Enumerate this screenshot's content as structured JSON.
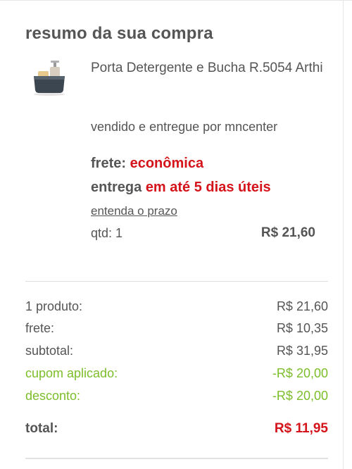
{
  "summary": {
    "title": "resumo da sua compra"
  },
  "product": {
    "image_icon": "soap-dispenser-icon",
    "name": "Porta Detergente e Bucha R.5054 Arthi",
    "seller_text": "vendido e entregue por mncenter",
    "shipping_label": "frete:",
    "shipping_type": "econômica",
    "delivery_label": "entrega",
    "delivery_value": "em até 5 dias úteis",
    "deadline_link": "entenda o prazo",
    "quantity_text": "qtd: 1",
    "price": "R$ 21,60"
  },
  "totals": {
    "rows": [
      {
        "label": "1 produto:",
        "value": "R$ 21,60"
      },
      {
        "label": "frete:",
        "value": "R$ 10,35"
      },
      {
        "label": "subtotal:",
        "value": "R$ 31,95"
      },
      {
        "label": "cupom aplicado:",
        "value": "-R$ 20,00"
      },
      {
        "label": "desconto:",
        "value": "-R$ 20,00"
      }
    ],
    "total_label": "total:",
    "total_value": "R$ 11,95"
  },
  "colors": {
    "text": "#555555",
    "accent_red": "#d4131a",
    "discount_green": "#7cbd2a"
  }
}
